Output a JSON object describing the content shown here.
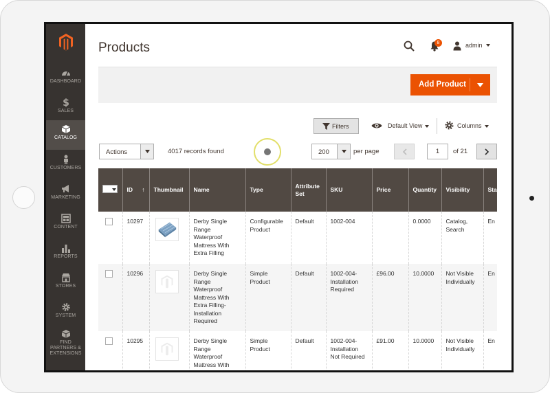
{
  "sidebar": {
    "items": [
      {
        "label": "Dashboard",
        "icon": "dashboard-icon"
      },
      {
        "label": "Sales",
        "icon": "dollar-icon"
      },
      {
        "label": "Catalog",
        "icon": "box-icon",
        "active": true
      },
      {
        "label": "Customers",
        "icon": "person-icon"
      },
      {
        "label": "Marketing",
        "icon": "megaphone-icon"
      },
      {
        "label": "Content",
        "icon": "layout-icon"
      },
      {
        "label": "Reports",
        "icon": "bar-chart-icon"
      },
      {
        "label": "Stores",
        "icon": "store-icon"
      },
      {
        "label": "System",
        "icon": "gear-icon"
      },
      {
        "label": "Find Partners & Extensions",
        "icon": "puzzle-box-icon"
      }
    ]
  },
  "header": {
    "title": "Products",
    "notifications_count": "8",
    "user_name": "admin"
  },
  "actions": {
    "add_product": "Add Product"
  },
  "toolbar": {
    "filters": "Filters",
    "view": "Default View",
    "columns": "Columns",
    "mass_actions": "Actions",
    "records_found": "4017 records found",
    "per_page_value": "200",
    "per_page_label": "per page",
    "current_page": "1",
    "total_pages": "of 21"
  },
  "grid": {
    "columns": [
      "ID",
      "Thumbnail",
      "Name",
      "Type",
      "Attribute Set",
      "SKU",
      "Price",
      "Quantity",
      "Visibility",
      "Sta"
    ],
    "rows": [
      {
        "id": "10297",
        "name": "Derby Single Range Waterproof Mattress With Extra Filling",
        "type": "Configurable Product",
        "attribute_set": "Default",
        "sku": "1002-004",
        "price": "",
        "quantity": "0.0000",
        "visibility": "Catalog, Search",
        "status": "En"
      },
      {
        "id": "10296",
        "name": "Derby Single Range Waterproof Mattress With Extra Filling-Installation Required",
        "type": "Simple Product",
        "attribute_set": "Default",
        "sku": "1002-004-Installation Required",
        "price": "£96.00",
        "quantity": "10.0000",
        "visibility": "Not Visible Individually",
        "status": "En"
      },
      {
        "id": "10295",
        "name": "Derby Single Range Waterproof Mattress With",
        "type": "Simple Product",
        "attribute_set": "Default",
        "sku": "1002-004-Installation Not Required",
        "price": "£91.00",
        "quantity": "10.0000",
        "visibility": "Not Visible Individually",
        "status": "En"
      }
    ]
  },
  "colors": {
    "accent": "#eb5202",
    "sidebar": "#373330",
    "grid_header": "#514943"
  }
}
